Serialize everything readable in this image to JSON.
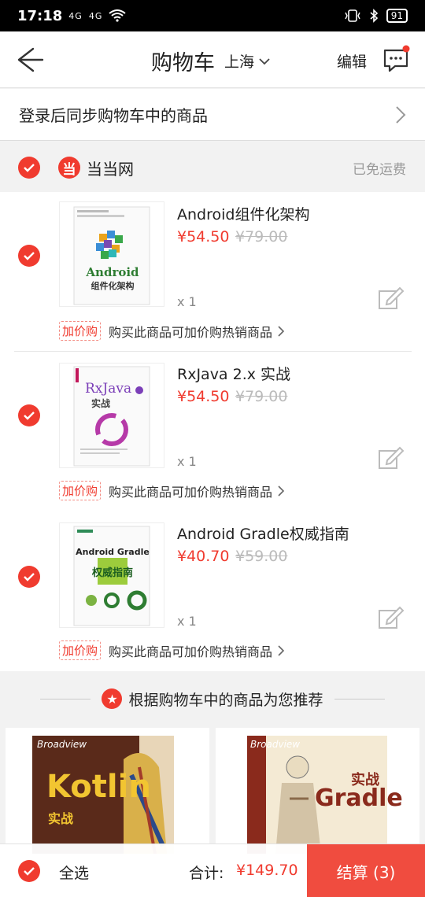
{
  "status": {
    "time": "17:18",
    "sig1": "4G",
    "sig2": "4G",
    "battery": "91"
  },
  "header": {
    "title": "购物车",
    "city": "上海",
    "edit": "编辑"
  },
  "login_bar": {
    "text": "登录后同步购物车中的商品"
  },
  "shop": {
    "logo": "当",
    "name": "当当网",
    "shipping": "已免运费"
  },
  "items": [
    {
      "title": "Android组件化架构",
      "price": "¥54.50",
      "orig": "¥79.00",
      "qty": "x 1",
      "cover_text": "Android",
      "cover_sub": "组件化架构"
    },
    {
      "title": "RxJava 2.x 实战",
      "price": "¥54.50",
      "orig": "¥79.00",
      "qty": "x 1",
      "cover_text": "RxJava",
      "cover_sub": "实战"
    },
    {
      "title": "Android Gradle权威指南",
      "price": "¥40.70",
      "orig": "¥59.00",
      "qty": "x 1",
      "cover_text": "Android Gradle",
      "cover_sub": "权威指南"
    }
  ],
  "promo": {
    "tag": "加价购",
    "text": "购买此商品可加价购热销商品"
  },
  "recommend": {
    "title": "根据购物车中的商品为您推荐",
    "cards": [
      {
        "title": "Kotlin",
        "sub": "实战",
        "publisher": "Broadview"
      },
      {
        "title": "Gradle",
        "sub": "实战",
        "publisher": "Broadview"
      }
    ]
  },
  "bottom": {
    "select_all": "全选",
    "total_label": "合计:",
    "total": "¥149.70",
    "checkout": "结算 (3)"
  },
  "colors": {
    "accent": "#f03b2f"
  }
}
